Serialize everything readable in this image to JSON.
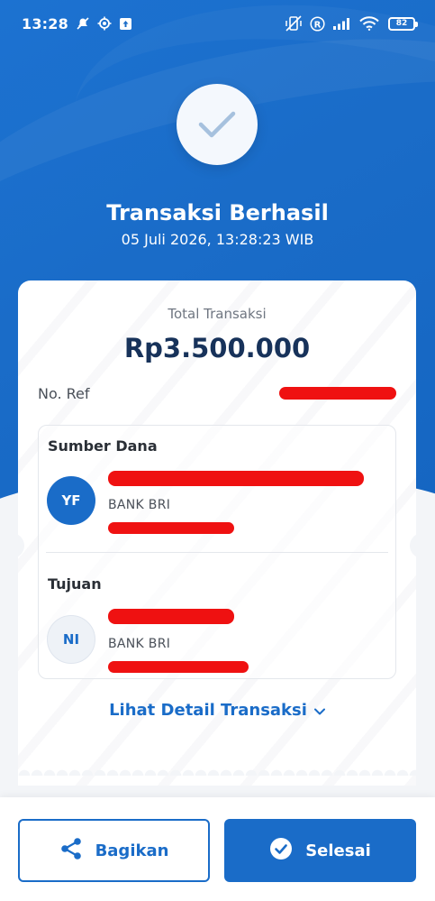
{
  "status_bar": {
    "time": "13:28",
    "battery": "82",
    "icons": [
      "notification-muted-icon",
      "location-icon",
      "upload-icon",
      "vibrate-off-icon",
      "registered-icon",
      "signal-icon",
      "wifi-icon",
      "battery-icon"
    ]
  },
  "header": {
    "icon": "checkmark-icon",
    "title": "Transaksi Berhasil",
    "datetime": "05 Juli 2026, 13:28:23 WIB"
  },
  "summary": {
    "total_label": "Total Transaksi",
    "total_amount": "Rp3.500.000",
    "ref_label": "No. Ref"
  },
  "source": {
    "title": "Sumber Dana",
    "initials": "YF",
    "bank": "BANK BRI"
  },
  "destination": {
    "title": "Tujuan",
    "initials": "NI",
    "bank": "BANK BRI"
  },
  "detail_link": "Lihat Detail Transaksi",
  "footer": {
    "share_label": "Bagikan",
    "done_label": "Selesai"
  },
  "colors": {
    "primary": "#1a6cc8",
    "amount_text": "#17325a",
    "redaction": "#ef1111"
  }
}
